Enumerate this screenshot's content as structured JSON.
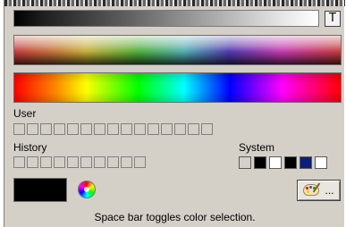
{
  "toolbar": {
    "t_button_label": "T"
  },
  "sections": {
    "user_label": "User",
    "history_label": "History",
    "system_label": "System"
  },
  "swatches": {
    "user_count": 15,
    "history_count": 10,
    "system_colors": [
      "#d4d0c8",
      "#000000",
      "#ffffff",
      "#000000",
      "#0a1f7a",
      "#ffffff"
    ]
  },
  "current_color": "#000000",
  "buttons": {
    "palette_ellipsis": "..."
  },
  "status_text": "Space bar toggles color selection."
}
